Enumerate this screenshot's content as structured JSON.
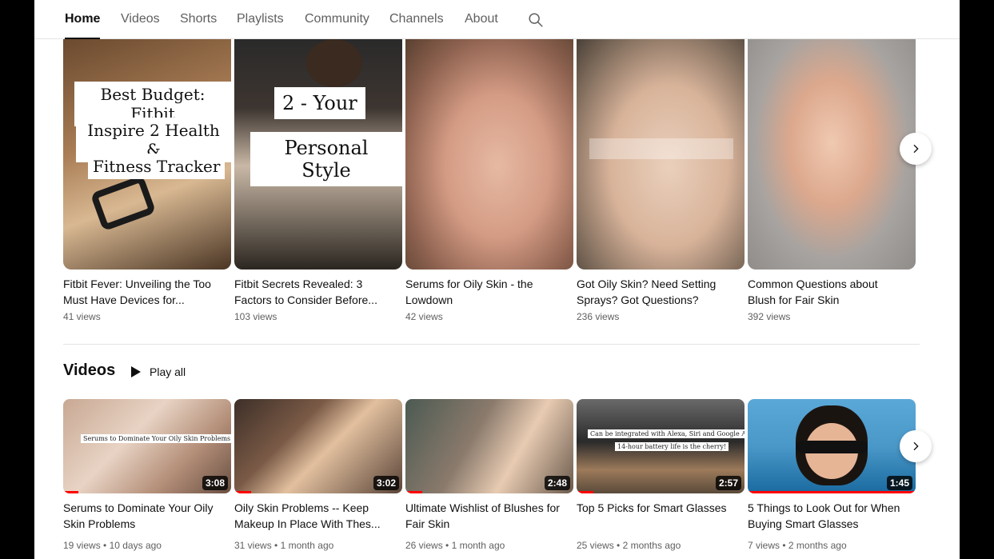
{
  "tabs": [
    {
      "label": "Home",
      "active": true
    },
    {
      "label": "Videos",
      "active": false
    },
    {
      "label": "Shorts",
      "active": false
    },
    {
      "label": "Playlists",
      "active": false
    },
    {
      "label": "Community",
      "active": false
    },
    {
      "label": "Channels",
      "active": false
    },
    {
      "label": "About",
      "active": false
    }
  ],
  "shorts": [
    {
      "title": "Fitbit Fever: Unveiling the Too Must Have Devices for...",
      "views": "41 views",
      "overlay": [
        "Best Budget: Fitbit",
        "Inspire 2 Health &",
        "Fitness Tracker"
      ]
    },
    {
      "title": "Fitbit Secrets Revealed: 3 Factors to Consider Before...",
      "views": "103 views",
      "overlay": [
        "2 - Your",
        "Personal Style"
      ]
    },
    {
      "title": "Serums for Oily Skin - the Lowdown",
      "views": "42 views"
    },
    {
      "title": "Got Oily Skin? Need Setting Sprays? Got Questions?",
      "views": "236 views"
    },
    {
      "title": "Common Questions about Blush for Fair Skin",
      "views": "392 views"
    }
  ],
  "videos_section": {
    "title": "Videos",
    "play_all": "Play all"
  },
  "videos": [
    {
      "title": "Serums to Dominate Your Oily Skin Problems",
      "views": "19 views",
      "age": "10 days ago",
      "duration": "3:08",
      "progress": 0.09,
      "caption": [
        "Serums to Dominate Your Oily Skin Problems!"
      ]
    },
    {
      "title": "Oily Skin Problems -- Keep Makeup In Place With Thes...",
      "views": "31 views",
      "age": "1 month ago",
      "duration": "3:02",
      "progress": 0.1
    },
    {
      "title": "Ultimate Wishlist of Blushes for Fair Skin",
      "views": "26 views",
      "age": "1 month ago",
      "duration": "2:48",
      "progress": 0.1
    },
    {
      "title": "Top 5 Picks for Smart Glasses",
      "views": "25 views",
      "age": "2 months ago",
      "duration": "2:57",
      "progress": 0.1,
      "caption": [
        "Can be integrated with Alexa, Siri and Google Assistant.",
        "14-hour battery life is the cherry!"
      ]
    },
    {
      "title": "5 Things to Look Out for When Buying Smart Glasses",
      "views": "7 views",
      "age": "2 months ago",
      "duration": "1:45",
      "progress": 1.0
    }
  ],
  "meta_separator": "•",
  "icons": {
    "search": "search-icon",
    "next": "chevron-right-icon",
    "play": "play-icon"
  }
}
